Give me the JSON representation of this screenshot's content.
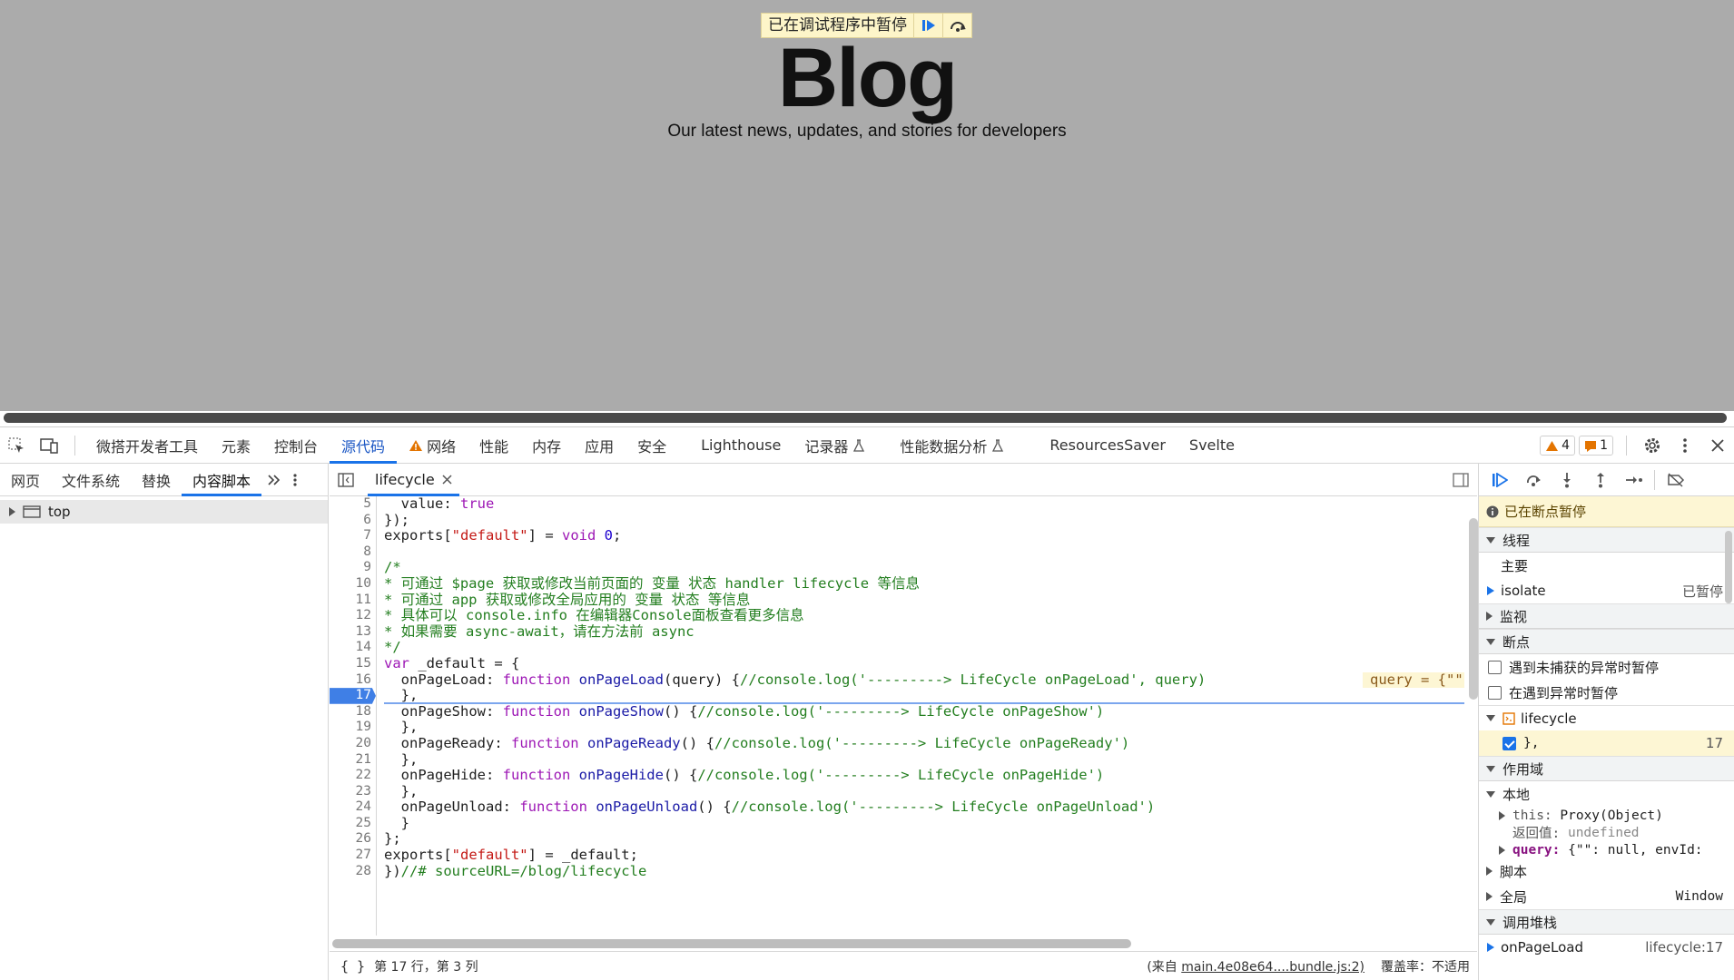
{
  "viewport": {
    "paused_banner": "已在调试程序中暂停",
    "blog_title": "Blog",
    "blog_subtitle": "Our latest news, updates, and stories for developers"
  },
  "main_tabs": [
    "微搭开发者工具",
    "元素",
    "控制台",
    "源代码",
    "网络",
    "性能",
    "内存",
    "应用",
    "安全",
    "Lighthouse",
    "记录器",
    "性能数据分析",
    "ResourcesSaver",
    "Svelte"
  ],
  "active_main_tab": "源代码",
  "badges": {
    "warnings": "4",
    "issues": "1"
  },
  "nav_tabs": [
    "网页",
    "文件系统",
    "替换",
    "内容脚本"
  ],
  "active_nav_tab": "内容脚本",
  "nav_tree": {
    "top": "top"
  },
  "editor": {
    "file_tab": "lifecycle",
    "line_numbers": [
      "5",
      "6",
      "7",
      "8",
      "9",
      "10",
      "11",
      "12",
      "13",
      "14",
      "15",
      "16",
      "17",
      "18",
      "19",
      "20",
      "21",
      "22",
      "23",
      "24",
      "25",
      "26",
      "27",
      "28"
    ],
    "current_line": "17",
    "inline_value": "query = {\"\": null, envId"
  },
  "status": {
    "position": "第 17 行，第 3 列",
    "source_prefix": "(来自",
    "source_link": "main.4e08e64....bundle.js:2)",
    "coverage": "覆盖率：不适用"
  },
  "debugger": {
    "paused_message": "已在断点暂停",
    "threads_label": "线程",
    "thread_main": "主要",
    "thread_isolate": "isolate",
    "thread_isolate_state": "已暂停",
    "watch_label": "监视",
    "breakpoints_label": "断点",
    "pause_uncaught": "遇到未捕获的异常时暂停",
    "pause_caught": "在遇到异常时暂停",
    "bp_file": "lifecycle",
    "bp_code": "},",
    "bp_line": "17",
    "scope_label": "作用域",
    "local_label": "本地",
    "this_key": "this:",
    "this_val": "Proxy(Object)",
    "return_key": "返回值:",
    "return_val": "undefined",
    "query_key": "query:",
    "query_val": "{\"\": null, envId:",
    "script_label": "脚本",
    "global_label": "全局",
    "global_val": "Window",
    "callstack_label": "调用堆栈",
    "frame_name": "onPageLoad",
    "frame_loc": "lifecycle:17"
  },
  "colors": {
    "accent": "#1a73e8",
    "paused_bg": "#fdf6d4",
    "page_bg": "#ababab"
  }
}
